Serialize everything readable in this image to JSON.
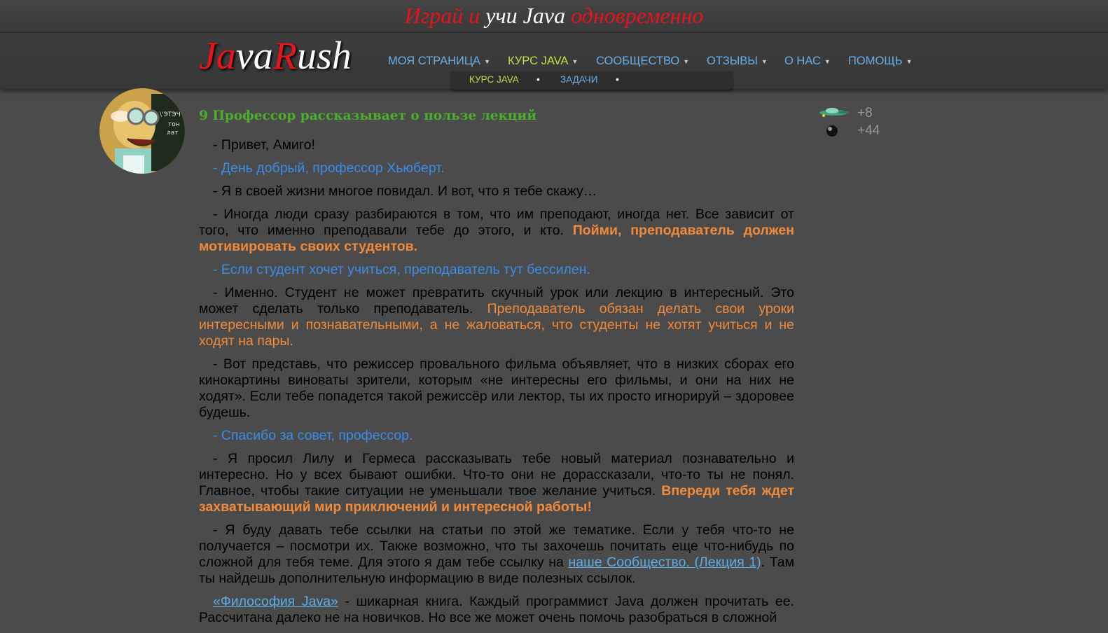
{
  "banner": {
    "part1": "Играй и",
    "part2": " учи Java ",
    "part3": "одновременно"
  },
  "logo": {
    "j": "J",
    "a1": "a",
    "va": "va",
    "r": "R",
    "ush": "ush"
  },
  "nav": {
    "items": [
      {
        "label": "МОЯ СТРАНИЦА"
      },
      {
        "label": "КУРС JAVA"
      },
      {
        "label": "СООБЩЕСТВО"
      },
      {
        "label": "ОТЗЫВЫ"
      },
      {
        "label": "О НАС"
      },
      {
        "label": "ПОМОЩЬ"
      }
    ],
    "active": "КУРС JAVA",
    "sub_items": [
      {
        "label": "КУРС JAVA"
      },
      {
        "label": "ЗАДАЧИ"
      }
    ]
  },
  "colors": {
    "background": "#4b4b4b",
    "nav_link": "#6aaee6",
    "nav_active": "#b8e04a",
    "title": "#4cae2a",
    "amigo": "#3d8be8",
    "highlight": "#f08a3c"
  },
  "lesson": {
    "title": "9 Профессор рассказывает о пользе лекций",
    "p1": "- Привет, Амиго!",
    "p2": "- День добрый, профессор Хьюберт.",
    "p3": "- Я в своей жизни многое повидал. И вот, что я тебе скажу…",
    "p4a": "- Иногда люди сразу разбираются в том, что им преподают, иногда нет. Все зависит от того, что именно преподавали тебе до этого, и кто. ",
    "p4b": "Пойми, преподаватель должен мотивировать своих студентов.",
    "p5": "- Если студент хочет учиться, преподаватель тут бессилен.",
    "p6a": "- Именно. Студент не может превратить скучный урок или лекцию в интересный. Это может сделать только преподаватель. ",
    "p6b": "Преподаватель обязан делать свои уроки интересными и познавательными, а не жаловаться, что студенты не хотят учиться и не ходят на пары.",
    "p7": "- Вот представь, что режиссер провального фильма объявляет, что в низких сборах его кинокартины виноваты зрители, которым «не интересны его фильмы, и они на них не ходят». Если тебе попадется такой режиссёр или лектор, ты их просто игнорируй – здоровее будешь.",
    "p8": "- Спасибо за совет, профессор.",
    "p9a": "- Я просил Лилу и Гермеса рассказывать тебе новый материал познавательно и интересно. Но у всех бывают ошибки. Что-то они не дорассказали, что-то ты не понял. Главное, чтобы такие ситуации не уменьшали твое желание учиться. ",
    "p9b": "Впереди тебя ждет захватывающий мир приключений и интересной работы!",
    "p10a": "- Я буду давать тебе ссылки на статьи по этой же тематике. Если у тебя что-то не получается – посмотри их. Также возможно, что ты захочешь почитать еще что-нибудь по сложной для тебя теме. Для этого я дам тебе ссылку на ",
    "p10link": "наше Сообщество. (Лекция 1)",
    "p10b": ". Там ты найдешь дополнительную информацию в виде полезных ссылок.",
    "p11link": "«Философия Java»",
    "p11b": " - шикарная книга. Каждый программист Java должен прочитать ее. Рассчитана далеко не на новичков. Но все же может очень помочь разобраться в сложной"
  },
  "rewards": [
    {
      "icon": "spaceship-icon",
      "value": "+8"
    },
    {
      "icon": "black-matter-icon",
      "value": "+44"
    }
  ]
}
